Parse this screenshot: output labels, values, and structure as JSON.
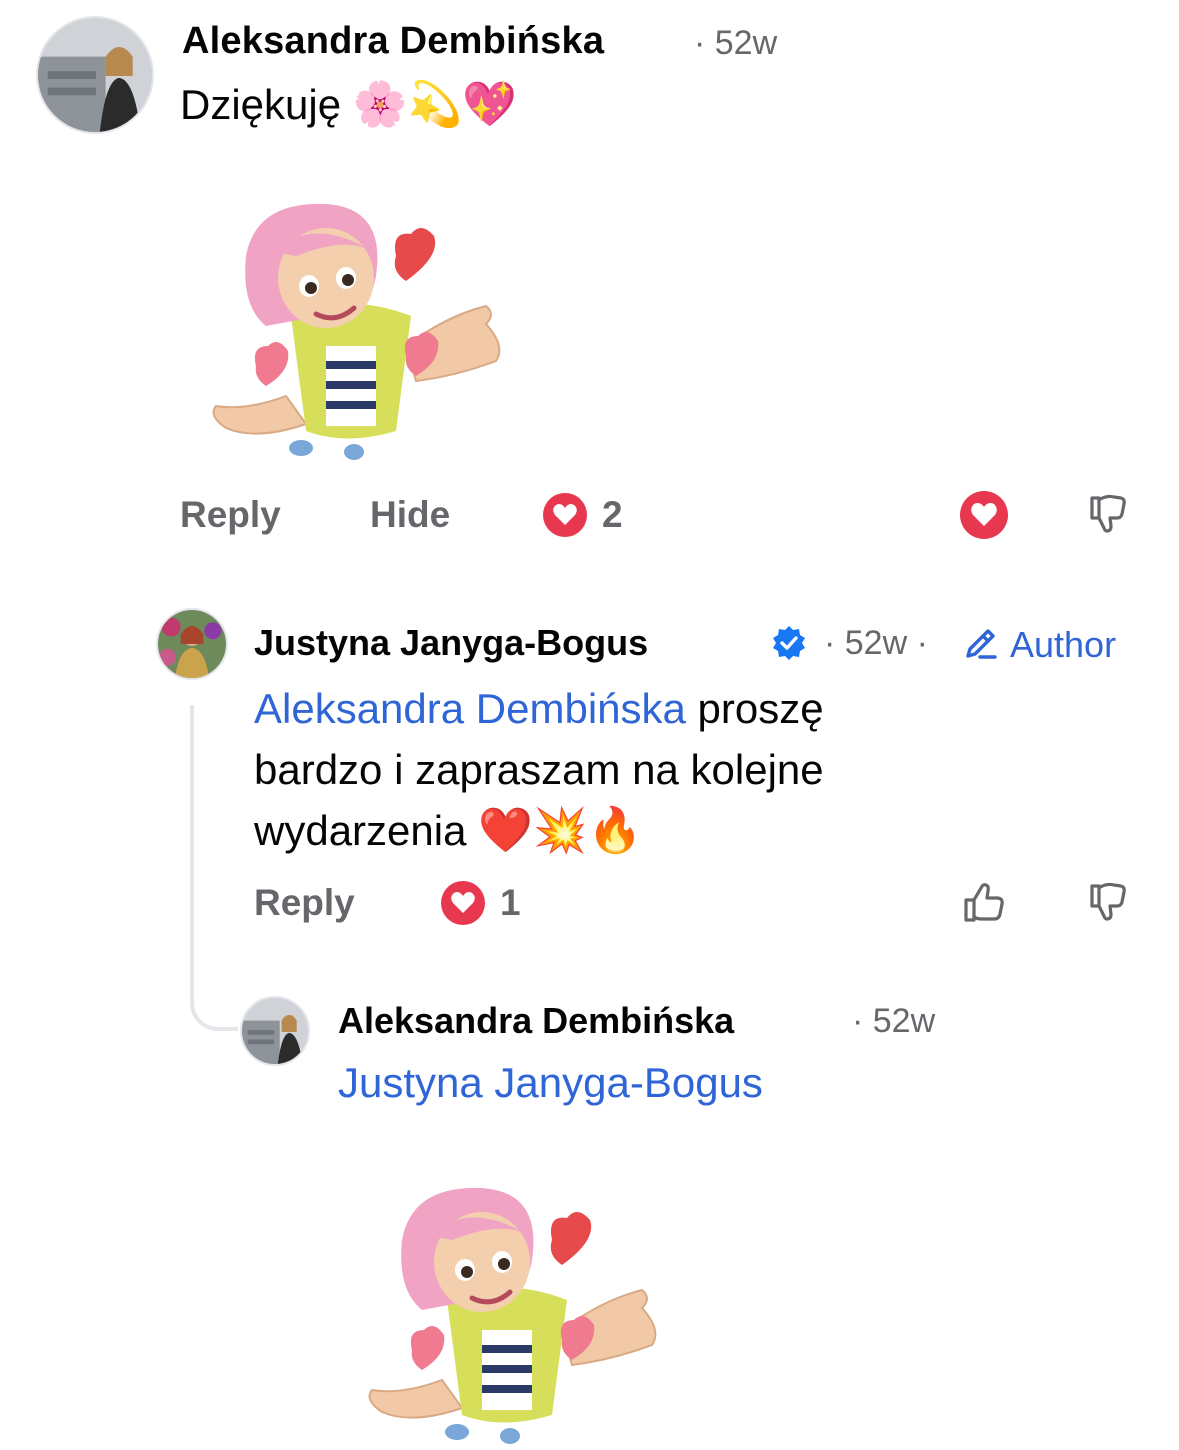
{
  "comment": {
    "author": "Aleksandra Dembińska",
    "time": "· 52w",
    "text": "Dziękuję",
    "emoji": "🌸💫💖",
    "actions": {
      "reply": "Reply",
      "hide": "Hide"
    },
    "reaction_count": "2"
  },
  "reply1": {
    "author": "Justyna Janyga-Bogus",
    "time": "· 52w ·",
    "badge_label": "Author",
    "mention": "Aleksandra Dembińska",
    "text_line1": " proszę",
    "text_line2": "bardzo i zapraszam na kolejne",
    "text_line3": "wydarzenia",
    "emoji": "❤️💥🔥",
    "actions": {
      "reply": "Reply"
    },
    "reaction_count": "1"
  },
  "reply2": {
    "author": "Aleksandra Dembińska",
    "time": "· 52w",
    "mention": "Justyna Janyga-Bogus"
  },
  "colors": {
    "mention": "#2f65d6",
    "heart_red": "#e8384f",
    "meta_gray": "#65676b",
    "verified_blue": "#1877f2"
  }
}
